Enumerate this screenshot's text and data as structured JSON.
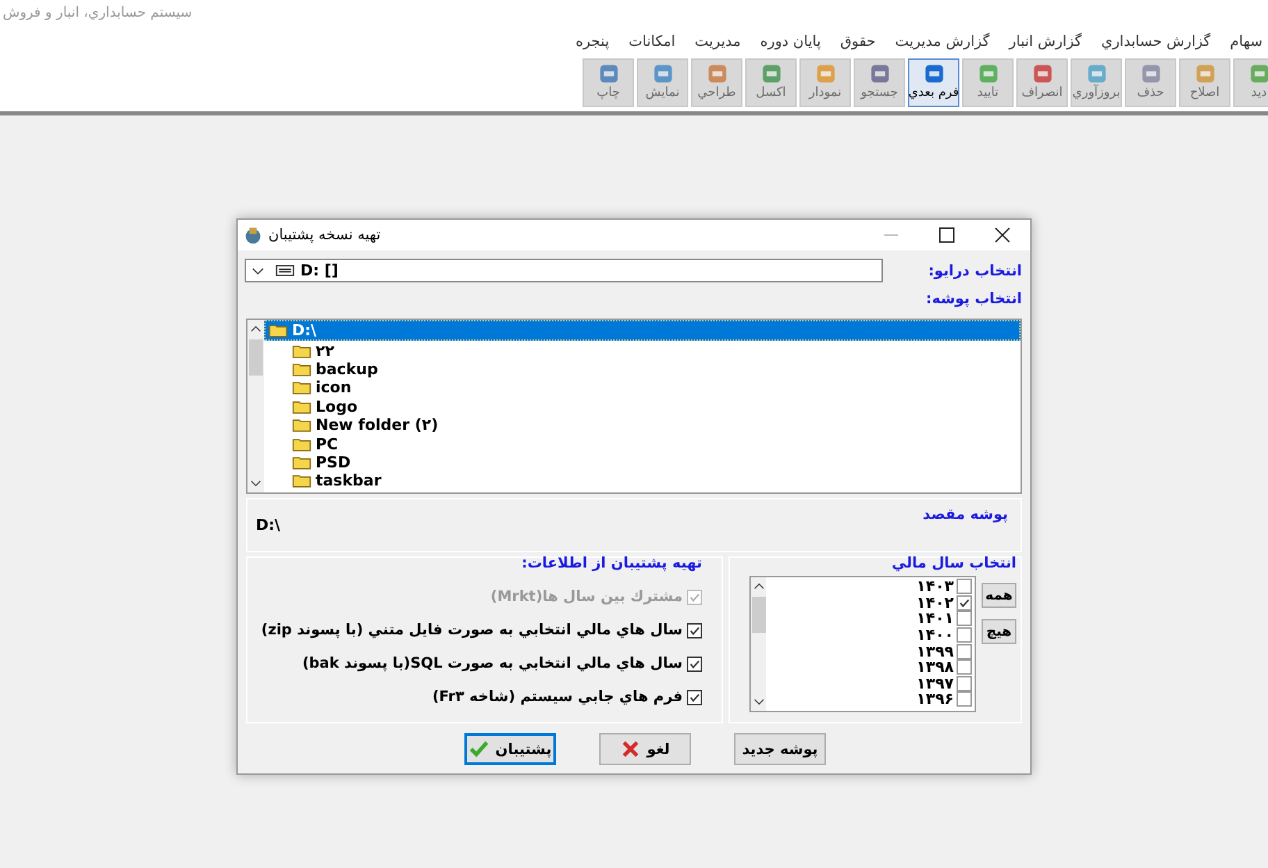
{
  "app": {
    "title": "سيستم حسابداري، انبار و فروش"
  },
  "menu": [
    "سهام",
    "گزارش حسابداري",
    "گزارش انبار",
    "گزارش مديريت",
    "حقوق",
    "پايان دوره",
    "مديريت",
    "امكانات",
    "پنجره"
  ],
  "toolbar": [
    {
      "label": "ديد",
      "disabled": true
    },
    {
      "label": "اصلاح",
      "disabled": true
    },
    {
      "label": "حذف",
      "disabled": true
    },
    {
      "label": "بروزآوري",
      "disabled": true
    },
    {
      "label": "انصراف",
      "disabled": true
    },
    {
      "label": "تاييد",
      "disabled": true
    },
    {
      "label": "فرم بعدي",
      "disabled": false
    },
    {
      "label": "جستجو",
      "disabled": true
    },
    {
      "label": "نمودار",
      "disabled": true
    },
    {
      "label": "اكسل",
      "disabled": true
    },
    {
      "label": "طراحي",
      "disabled": true
    },
    {
      "label": "نمايش",
      "disabled": true
    },
    {
      "label": "چاپ",
      "disabled": true
    }
  ],
  "dialog": {
    "title": "تهيه نسخه پشتيبان",
    "drive_label": "انتخاب درايو:",
    "drive_value": "D: []",
    "folder_label": "انتخاب پوشه:",
    "folder_tree": {
      "label": "D:\\",
      "selected": true,
      "children": [
        {
          "label": "۲۲",
          "selected": false
        },
        {
          "label": "backup",
          "selected": false
        },
        {
          "label": "icon",
          "selected": false
        },
        {
          "label": "Logo",
          "selected": false
        },
        {
          "label": "New folder (۲)",
          "selected": false
        },
        {
          "label": "PC",
          "selected": false
        },
        {
          "label": "PSD",
          "selected": false
        },
        {
          "label": "taskbar",
          "selected": false
        }
      ]
    },
    "destination_label": "پوشه مقصد",
    "destination_value": "D:\\",
    "backup_group": {
      "title": "تهيه پشتيبان از اطلاعات:",
      "options": [
        {
          "label": "مشترك بين سال ها(Mrkt)",
          "checked": true,
          "disabled": true
        },
        {
          "label": "سال هاي مالي انتخابي به صورت فايل متني (با پسوند zip)",
          "checked": true,
          "disabled": false
        },
        {
          "label": "سال هاي مالي انتخابي به صورت SQL(با پسوند bak)",
          "checked": true,
          "disabled": false
        },
        {
          "label": "فرم هاي جابي سيستم (شاخه Fr۳)",
          "checked": true,
          "disabled": false
        }
      ]
    },
    "year_group": {
      "title": "انتخاب سال مالي",
      "buttons": [
        "همه",
        "هيچ"
      ],
      "years": [
        {
          "label": "۱۴۰۳",
          "checked": false
        },
        {
          "label": "۱۴۰۲",
          "checked": true
        },
        {
          "label": "۱۴۰۱",
          "checked": false
        },
        {
          "label": "۱۴۰۰",
          "checked": false
        },
        {
          "label": "۱۳۹۹",
          "checked": false
        },
        {
          "label": "۱۳۹۸",
          "checked": false
        },
        {
          "label": "۱۳۹۷",
          "checked": false
        },
        {
          "label": "۱۳۹۶",
          "checked": false
        }
      ]
    },
    "buttons": [
      {
        "label": "پوشه جديد",
        "kind": "plain",
        "default": false
      },
      {
        "label": "لغو",
        "kind": "cancel",
        "default": false
      },
      {
        "label": "پشتيبان",
        "kind": "ok",
        "default": true
      }
    ]
  }
}
